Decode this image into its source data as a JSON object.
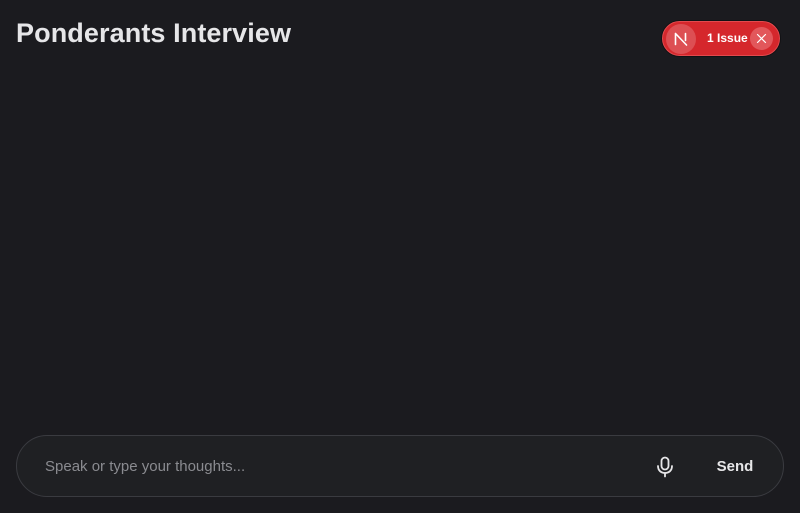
{
  "header": {
    "title": "Ponderants Interview"
  },
  "dev_indicator": {
    "badge_letter": "N",
    "badge_icon": "nextjs-logo-icon",
    "issues_label": "1 Issue",
    "close_icon": "close-icon",
    "colors": {
      "pill": "#d5272c",
      "badge": "#dd4f53"
    }
  },
  "composer": {
    "placeholder": "Speak or type your thoughts...",
    "value": "",
    "mic_icon": "microphone-icon",
    "send_label": "Send"
  },
  "theme": {
    "background": "#1b1b1f",
    "text": "#e6e6e8"
  }
}
